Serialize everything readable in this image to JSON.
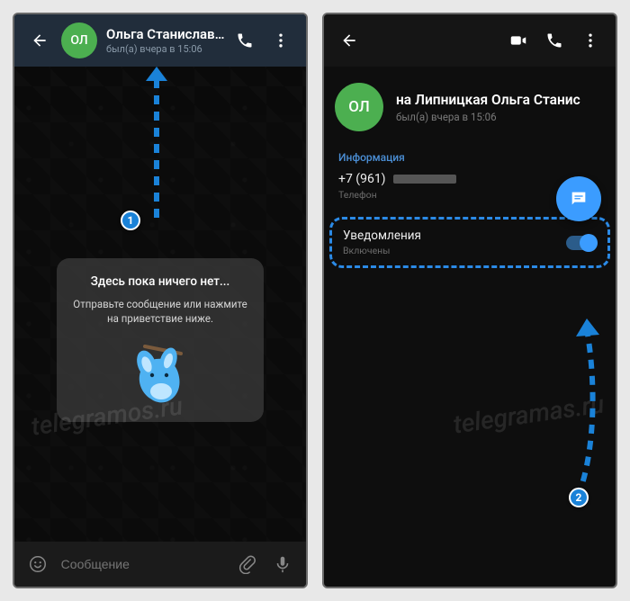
{
  "left": {
    "avatar_initials": "ОЛ",
    "title": "Ольга Станиславо...",
    "subtitle": "был(а) вчера в 15:06",
    "empty_title": "Здесь пока ничего нет...",
    "empty_text": "Отправьте сообщение или нажмите на приветствие ниже.",
    "input_placeholder": "Сообщение",
    "watermark": "telegramos.ru"
  },
  "right": {
    "avatar_initials": "ОЛ",
    "name_full": "на Липницкая   Ольга Станис",
    "status": "был(а) вчера в 15:06",
    "info_label": "Информация",
    "phone_prefix": "+7 (961)",
    "phone_label": "Телефон",
    "notif_title": "Уведомления",
    "notif_status": "Включены",
    "watermark": "telegramas.ru"
  },
  "badges": {
    "one": "1",
    "two": "2"
  }
}
